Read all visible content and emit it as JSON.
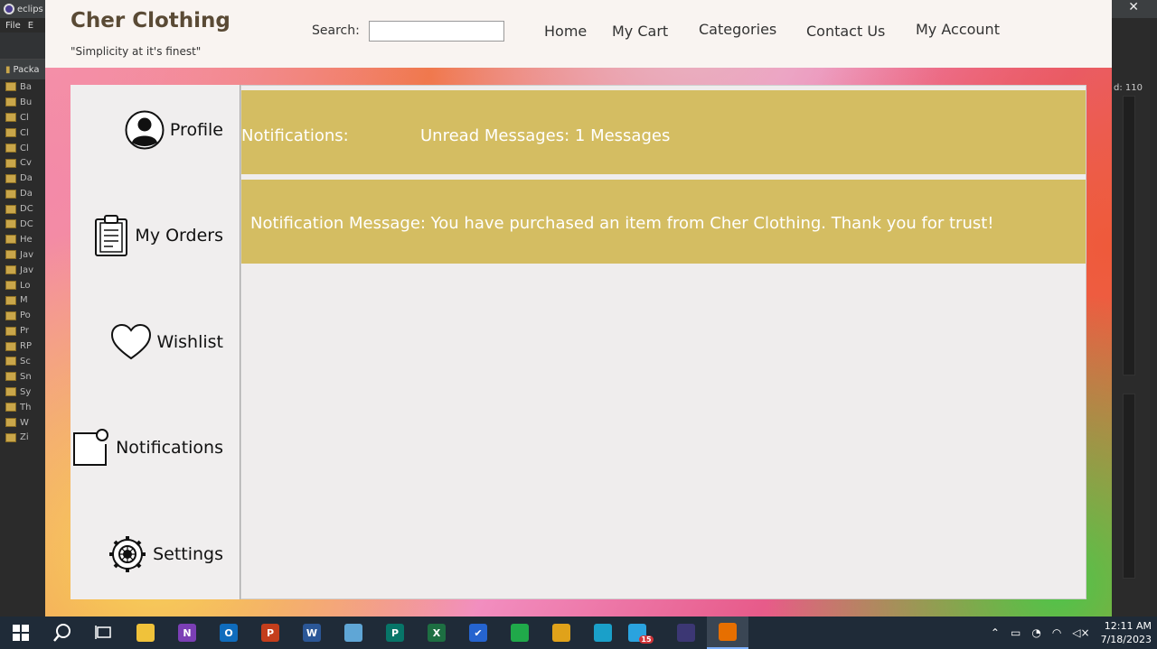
{
  "ide": {
    "title": "eclips",
    "menu": [
      "File",
      "E"
    ],
    "package_tab": "Packa",
    "tree": [
      "Ba",
      "Bu",
      "Cl",
      "Cl",
      "Cl",
      "Cv",
      "Da",
      "Da",
      "DC",
      "DC",
      "He",
      "Jav",
      "Jav",
      "Lo",
      "M",
      "Po",
      "Pr",
      "RP",
      "Sc",
      "Sn",
      "Sy",
      "Th",
      "W",
      "Zi"
    ],
    "right_label": "d: 110"
  },
  "header": {
    "brand_title": "Cher Clothing",
    "brand_tagline": "\"Simplicity at it's finest\"",
    "search_label": "Search:",
    "search_value": "",
    "nav": {
      "home": "Home",
      "cart": "My Cart",
      "categories": "Categories",
      "contact": "Contact Us",
      "account": "My Account"
    }
  },
  "sidebar": {
    "profile": "Profile",
    "orders": "My Orders",
    "wishlist": "Wishlist",
    "notifications": "Notifications",
    "settings": "Settings"
  },
  "content": {
    "notifications_title": "Notifications:",
    "unread": "Unread Messages: 1 Messages",
    "message": "Notification Message: You have purchased an item from Cher Clothing. Thank you for trust!"
  },
  "colors": {
    "notif_bg": "#d4bd62",
    "brand": "#5a4a35"
  },
  "taskbar": {
    "apps": [
      {
        "name": "file-explorer",
        "label": "",
        "color": "#f0c23a"
      },
      {
        "name": "onenote",
        "label": "N",
        "color": "#7b3fb5"
      },
      {
        "name": "outlook",
        "label": "O",
        "color": "#0f6cbd"
      },
      {
        "name": "powerpoint",
        "label": "P",
        "color": "#c43e1c"
      },
      {
        "name": "word",
        "label": "W",
        "color": "#2b5797"
      },
      {
        "name": "paint",
        "label": "",
        "color": "#5fa6d6"
      },
      {
        "name": "publisher",
        "label": "P",
        "color": "#077568"
      },
      {
        "name": "excel",
        "label": "X",
        "color": "#1d6f42"
      },
      {
        "name": "todo",
        "label": "✔",
        "color": "#2564cf"
      },
      {
        "name": "green-app",
        "label": "",
        "color": "#20a94a"
      },
      {
        "name": "chrome",
        "label": "",
        "color": "#e0a21a"
      },
      {
        "name": "edge",
        "label": "",
        "color": "#1aa0c9"
      },
      {
        "name": "telegram",
        "label": "",
        "color": "#2aa3df"
      },
      {
        "name": "eclipse",
        "label": "",
        "color": "#3c3774"
      },
      {
        "name": "java",
        "label": "",
        "color": "#e76f00"
      }
    ],
    "telegram_badge": "15",
    "time": "12:11 AM",
    "date": "7/18/2023"
  }
}
